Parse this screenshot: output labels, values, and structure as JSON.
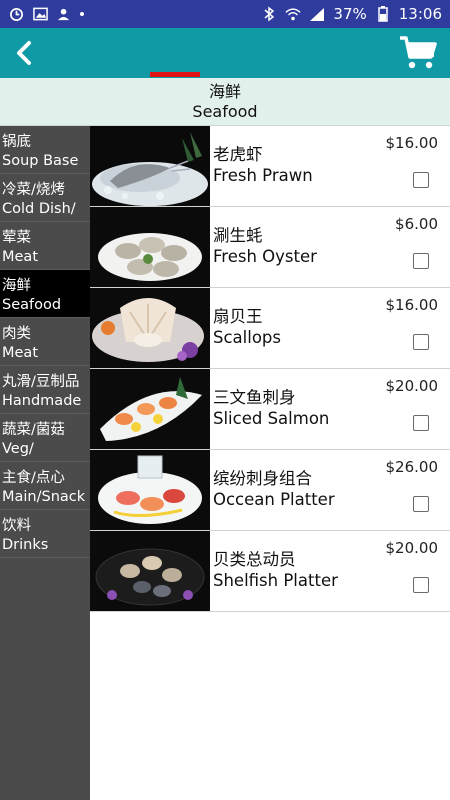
{
  "status_bar": {
    "battery": "37%",
    "time": "13:06"
  },
  "header": {
    "category_cn": "海鲜",
    "category_en": "Seafood"
  },
  "sidebar": {
    "items": [
      {
        "cn": "锅底",
        "en": "Soup Base"
      },
      {
        "cn": "冷菜/烧烤",
        "en": "Cold Dish/"
      },
      {
        "cn": "荤菜",
        "en": "Meat"
      },
      {
        "cn": "海鲜",
        "en": "Seafood"
      },
      {
        "cn": "肉类",
        "en": "Meat"
      },
      {
        "cn": "丸滑/豆制品",
        "en": "Handmade"
      },
      {
        "cn": "蔬菜/菌菇",
        "en": "Veg/"
      },
      {
        "cn": "主食/点心",
        "en": "Main/Snack"
      },
      {
        "cn": "饮料",
        "en": "Drinks"
      }
    ]
  },
  "menu": {
    "items": [
      {
        "cn": "老虎虾",
        "en": "Fresh Prawn",
        "price": "$16.00",
        "checked": false
      },
      {
        "cn": "涮生蚝",
        "en": "Fresh Oyster",
        "price": "$6.00",
        "checked": false
      },
      {
        "cn": "扇贝王",
        "en": "Scallops",
        "price": "$16.00",
        "checked": false
      },
      {
        "cn": "三文鱼刺身",
        "en": "Sliced Salmon",
        "price": "$20.00",
        "checked": false
      },
      {
        "cn": "缤纷刺身组合",
        "en": "Occean Platter",
        "price": "$26.00",
        "checked": false
      },
      {
        "cn": "贝类总动员",
        "en": "Shelfish Platter",
        "price": "$20.00",
        "checked": false
      }
    ]
  },
  "colors": {
    "status_bar": "#2f3c9e",
    "toolbar": "#0f9aa6",
    "tab_indicator": "#e01414",
    "sidebar": "#4b4b4b",
    "sidebar_active": "#000000",
    "header_bg": "#e3f1ec"
  },
  "icons": {
    "back": "chevron-left-icon",
    "cart": "shopping-cart-icon"
  }
}
